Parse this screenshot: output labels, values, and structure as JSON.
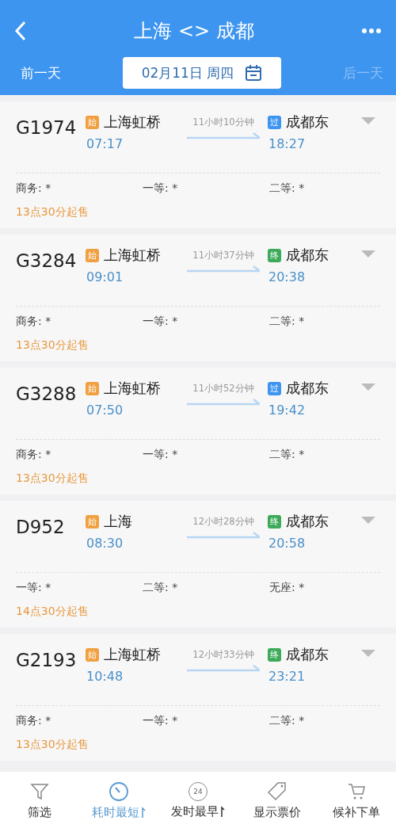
{
  "header": {
    "title": "上海 <> 成都",
    "prev_day": "前一天",
    "date": "02月11日 周四",
    "next_day": "后一天",
    "next_day_disabled": true
  },
  "trains": [
    {
      "number": "G1974",
      "from_badge": {
        "kind": "start",
        "text": "始"
      },
      "from": "上海虹桥",
      "depart": "07:17",
      "duration": "11小时10分钟",
      "to_badge": {
        "kind": "pass",
        "text": "过"
      },
      "to": "成都东",
      "arrive": "18:27",
      "seats": [
        {
          "label": "商务:",
          "value": "*"
        },
        {
          "label": "一等:",
          "value": "*"
        },
        {
          "label": "二等:",
          "value": "*"
        }
      ],
      "sale": "13点30分起售"
    },
    {
      "number": "G3284",
      "from_badge": {
        "kind": "start",
        "text": "始"
      },
      "from": "上海虹桥",
      "depart": "09:01",
      "duration": "11小时37分钟",
      "to_badge": {
        "kind": "end",
        "text": "终"
      },
      "to": "成都东",
      "arrive": "20:38",
      "seats": [
        {
          "label": "商务:",
          "value": "*"
        },
        {
          "label": "一等:",
          "value": "*"
        },
        {
          "label": "二等:",
          "value": "*"
        }
      ],
      "sale": "13点30分起售"
    },
    {
      "number": "G3288",
      "from_badge": {
        "kind": "start",
        "text": "始"
      },
      "from": "上海虹桥",
      "depart": "07:50",
      "duration": "11小时52分钟",
      "to_badge": {
        "kind": "pass",
        "text": "过"
      },
      "to": "成都东",
      "arrive": "19:42",
      "seats": [
        {
          "label": "商务:",
          "value": "*"
        },
        {
          "label": "一等:",
          "value": "*"
        },
        {
          "label": "二等:",
          "value": "*"
        }
      ],
      "sale": "13点30分起售"
    },
    {
      "number": "D952",
      "from_badge": {
        "kind": "start",
        "text": "始"
      },
      "from": "上海",
      "depart": "08:30",
      "duration": "12小时28分钟",
      "to_badge": {
        "kind": "end",
        "text": "终"
      },
      "to": "成都东",
      "arrive": "20:58",
      "seats": [
        {
          "label": "一等:",
          "value": "*"
        },
        {
          "label": "二等:",
          "value": "*"
        },
        {
          "label": "无座:",
          "value": "*"
        }
      ],
      "sale": "14点30分起售"
    },
    {
      "number": "G2193",
      "from_badge": {
        "kind": "start",
        "text": "始"
      },
      "from": "上海虹桥",
      "depart": "10:48",
      "duration": "12小时33分钟",
      "to_badge": {
        "kind": "end",
        "text": "终"
      },
      "to": "成都东",
      "arrive": "23:21",
      "seats": [
        {
          "label": "商务:",
          "value": "*"
        },
        {
          "label": "一等:",
          "value": "*"
        },
        {
          "label": "二等:",
          "value": "*"
        }
      ],
      "sale": "13点30分起售"
    }
  ],
  "bottom_tabs": [
    {
      "kind": "filter",
      "label": "筛选",
      "selected": false
    },
    {
      "kind": "duration",
      "label": "耗时最短",
      "selected": true,
      "sortable": true
    },
    {
      "kind": "earliest",
      "label": "发时最早",
      "selected": false,
      "sortable": true,
      "icon_text": "24"
    },
    {
      "kind": "price",
      "label": "显示票价",
      "selected": false
    },
    {
      "kind": "waitlist",
      "label": "候补下单",
      "selected": false
    }
  ]
}
